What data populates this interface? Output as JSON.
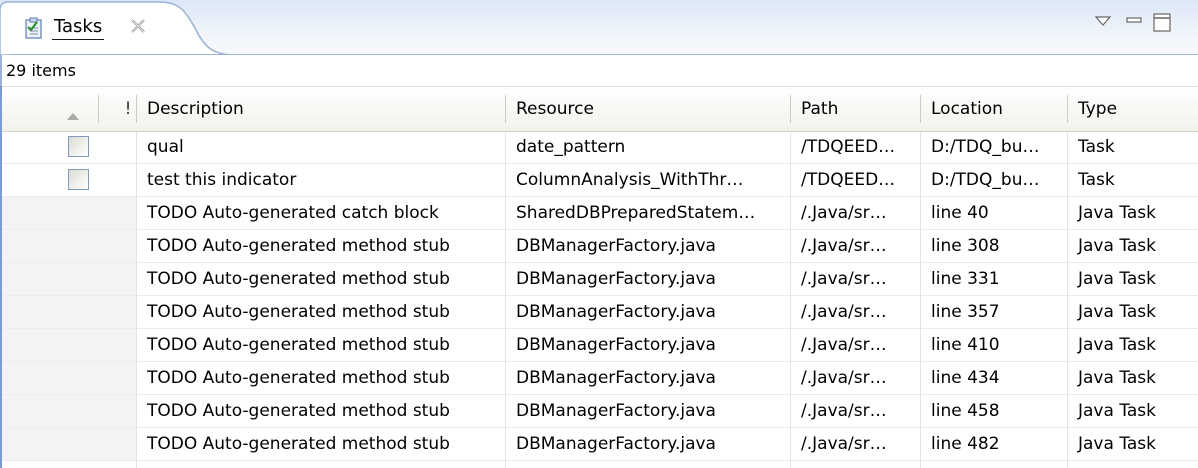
{
  "tab": {
    "title": "Tasks",
    "icon": "tasks-clipboard-icon",
    "close_icon": "close-x-icon"
  },
  "toolbar": {
    "view_menu_icon": "view-menu-triangle-icon",
    "minimize_icon": "minimize-icon",
    "maximize_icon": "maximize-icon"
  },
  "status": {
    "item_count": "29 items"
  },
  "table": {
    "columns": {
      "priority": "!",
      "description": "Description",
      "resource": "Resource",
      "path": "Path",
      "location": "Location",
      "type": "Type"
    },
    "sort_icon": "sort-ascending-icon",
    "rows": [
      {
        "checkbox": true,
        "description": "qual",
        "resource": "date_pattern",
        "path": "/TDQEED…",
        "location": "D:/TDQ_bu…",
        "type": "Task"
      },
      {
        "checkbox": true,
        "description": "test this indicator",
        "resource": " ColumnAnalysis_WithThr…",
        "path": "/TDQEED…",
        "location": "D:/TDQ_bu…",
        "type": "Task"
      },
      {
        "checkbox": false,
        "description": "TODO Auto-generated catch block",
        "resource": "SharedDBPreparedStatem…",
        "path": "/.Java/sr…",
        "location": "line 40",
        "type": "Java Task"
      },
      {
        "checkbox": false,
        "description": "TODO Auto-generated method stub",
        "resource": "DBManagerFactory.java",
        "path": "/.Java/sr…",
        "location": "line 308",
        "type": "Java Task"
      },
      {
        "checkbox": false,
        "description": "TODO Auto-generated method stub",
        "resource": "DBManagerFactory.java",
        "path": "/.Java/sr…",
        "location": "line 331",
        "type": "Java Task"
      },
      {
        "checkbox": false,
        "description": "TODO Auto-generated method stub",
        "resource": "DBManagerFactory.java",
        "path": "/.Java/sr…",
        "location": "line 357",
        "type": "Java Task"
      },
      {
        "checkbox": false,
        "description": "TODO Auto-generated method stub",
        "resource": "DBManagerFactory.java",
        "path": "/.Java/sr…",
        "location": "line 410",
        "type": "Java Task"
      },
      {
        "checkbox": false,
        "description": "TODO Auto-generated method stub",
        "resource": "DBManagerFactory.java",
        "path": "/.Java/sr…",
        "location": "line 434",
        "type": "Java Task"
      },
      {
        "checkbox": false,
        "description": "TODO Auto-generated method stub",
        "resource": "DBManagerFactory.java",
        "path": "/.Java/sr…",
        "location": "line 458",
        "type": "Java Task"
      },
      {
        "checkbox": false,
        "description": "TODO Auto-generated method stub",
        "resource": "DBManagerFactory.java",
        "path": "/.Java/sr…",
        "location": "line 482",
        "type": "Java Task"
      }
    ]
  }
}
